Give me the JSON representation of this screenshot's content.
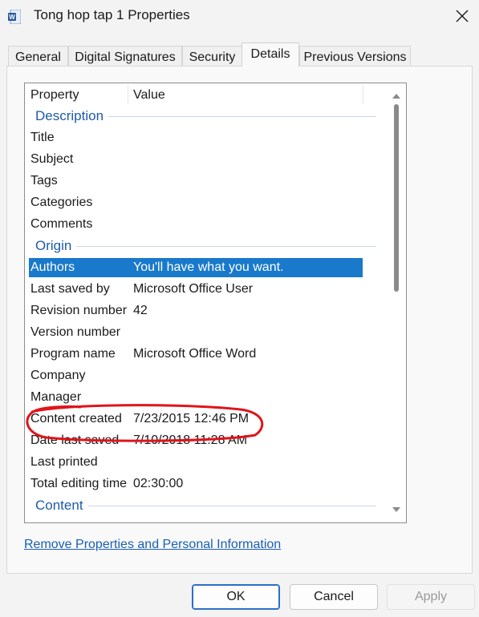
{
  "window": {
    "title": "Tong hop tap 1 Properties",
    "app_icon": "word-icon",
    "close_icon": "close-icon"
  },
  "tabs": [
    {
      "label": "General",
      "active": false
    },
    {
      "label": "Digital Signatures",
      "active": false
    },
    {
      "label": "Security",
      "active": false
    },
    {
      "label": "Details",
      "active": true
    },
    {
      "label": "Previous Versions",
      "active": false
    }
  ],
  "list": {
    "header": {
      "property": "Property",
      "value": "Value"
    },
    "groups": [
      {
        "name": "Description",
        "rows": [
          {
            "key": "Title",
            "value": ""
          },
          {
            "key": "Subject",
            "value": ""
          },
          {
            "key": "Tags",
            "value": ""
          },
          {
            "key": "Categories",
            "value": ""
          },
          {
            "key": "Comments",
            "value": ""
          }
        ]
      },
      {
        "name": "Origin",
        "rows": [
          {
            "key": "Authors",
            "value": "You'll have what you want.",
            "selected": true
          },
          {
            "key": "Last saved by",
            "value": "Microsoft Office User"
          },
          {
            "key": "Revision number",
            "value": "42"
          },
          {
            "key": "Version number",
            "value": ""
          },
          {
            "key": "Program name",
            "value": "Microsoft Office Word"
          },
          {
            "key": "Company",
            "value": ""
          },
          {
            "key": "Manager",
            "value": ""
          },
          {
            "key": "Content created",
            "value": "7/23/2015 12:46 PM",
            "circled": true
          },
          {
            "key": "Date last saved",
            "value": "7/10/2018 11:28 AM"
          },
          {
            "key": "Last printed",
            "value": ""
          },
          {
            "key": "Total editing time",
            "value": "02:30:00"
          }
        ]
      },
      {
        "name": "Content",
        "rows": []
      }
    ]
  },
  "link_text": "Remove Properties and Personal Information",
  "buttons": {
    "ok": "OK",
    "cancel": "Cancel",
    "apply": "Apply"
  },
  "colors": {
    "selection": "#1979ca",
    "group_heading": "#1e5aa8",
    "link": "#1a5fb4",
    "annotation": "#e0141b"
  }
}
